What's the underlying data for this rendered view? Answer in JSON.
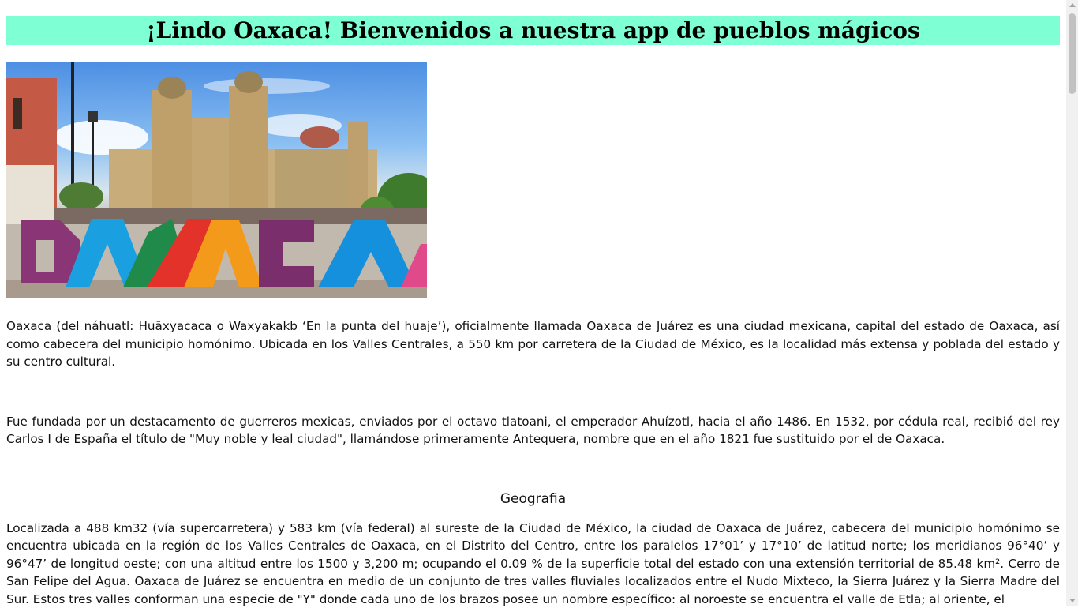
{
  "header": {
    "title": "¡Lindo Oaxaca! Bienvenidos a nuestra app de pueblos mágicos",
    "background_color": "#7fffd4"
  },
  "hero_image": {
    "alt": "OAXACA"
  },
  "content": {
    "paragraph_1": "Oaxaca (del náhuatl: Huāxyacaca o Waxyakakb ‘En la punta del huaje’), oficialmente llamada Oaxaca de Juárez es una ciudad mexicana, capital del estado de Oaxaca, así como cabecera del municipio homónimo. Ubicada en los Valles Centrales, a 550 km por carretera de la Ciudad de México, es la localidad más extensa y poblada del estado y su centro cultural.",
    "paragraph_2": "Fue fundada por un destacamento de guerreros mexicas, enviados por el octavo tlatoani, el emperador Ahuízotl, hacia el año 1486. En 1532, por cédula real, recibió del rey Carlos I de España el título de \"Muy noble y leal ciudad\", llamándose primeramente Antequera, nombre que en el año 1821 fue sustituido por el de Oaxaca.",
    "section_title": "Geografia",
    "paragraph_3": "Localizada a 488 km32 (vía supercarretera) y 583 km (vía federal) al sureste de la Ciudad de México, la ciudad de Oaxaca de Juárez, cabecera del municipio homónimo se encuentra ubicada en la región de los Valles Centrales de Oaxaca, en el Distrito del Centro, entre los paralelos 17°01’ y 17°10’ de latitud norte; los meridianos 96°40’ y 96°47’ de longitud oeste; con una altitud entre los 1500 y 3,200 m; ocupando el 0.09 % de la superficie total del estado con una extensión territorial de 85.48 km². Cerro de San Felipe del Agua. Oaxaca de Juárez se encuentra en medio de un conjunto de tres valles fluviales localizados entre el Nudo Mixteco, la Sierra Juárez y la Sierra Madre del Sur. Estos tres valles conforman una especie de \"Y\" donde cada uno de los brazos posee un nombre específico: al noroeste se encuentra el valle de Etla; al oriente, el"
  }
}
